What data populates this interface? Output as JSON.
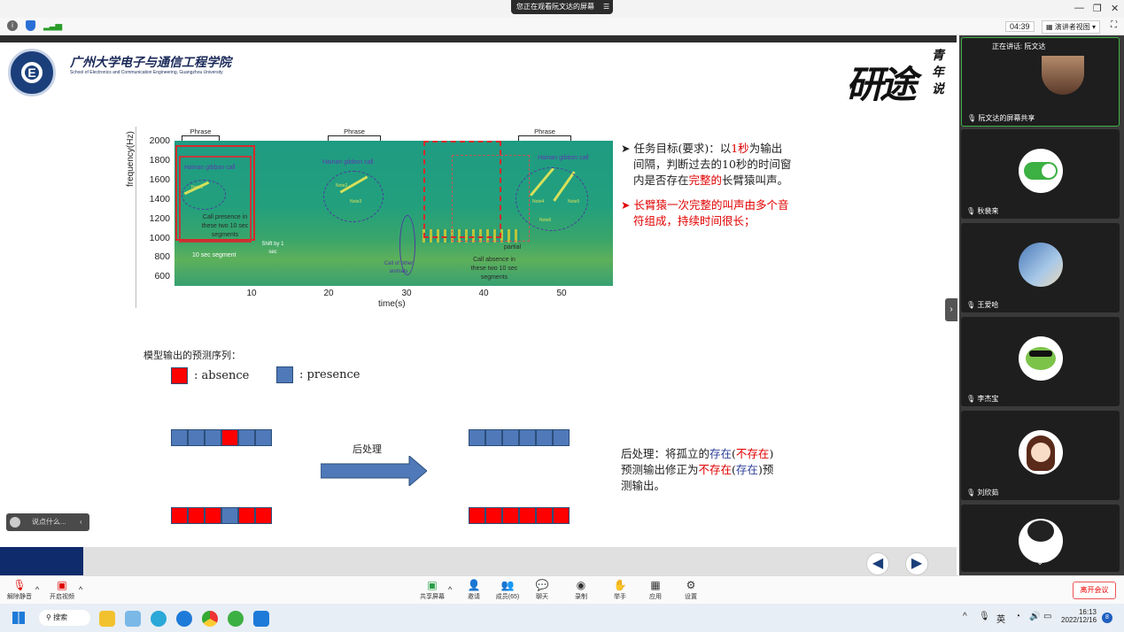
{
  "window": {
    "banner": "您正在观看阮文达的屏幕",
    "timer": "04:39",
    "view_mode": "演讲者视图"
  },
  "slide": {
    "school_cn": "广州大学电子与通信工程学院",
    "school_en": "School of Electronics and Communication Engineering, Guangzhou University",
    "brand": "研途",
    "brand_sub": "青年说",
    "spectrogram": {
      "ylabel": "frequency(Hz)",
      "xlabel": "time(s)",
      "yticks": [
        "2000",
        "1800",
        "1600",
        "1400",
        "1200",
        "1000",
        "800",
        "600"
      ],
      "xticks": [
        "10",
        "20",
        "30",
        "40",
        "50"
      ],
      "phrase_labels": [
        "Phrase",
        "Phrase",
        "Phrase"
      ],
      "annotations": {
        "gibbon1": "Hainan gibbon call",
        "gibbon2": "Hainan gibbon call",
        "gibbon3": "Hainan gibbon call",
        "note1": "Note1",
        "note2": "Note2",
        "note3": "Note3",
        "note4": "Note4",
        "note5": "Note5",
        "note6": "Note6",
        "presence": "Call presence in these two 10 sec segments",
        "shift": "Shift by 1 sec",
        "segment": "10 sec segment",
        "other": "Call of other animals",
        "absence": "Call absence in these two 10 sec segments",
        "partial": "partial"
      }
    },
    "task": {
      "line1_pre": "任务目标(要求)：以",
      "line1_red": "1秒",
      "line1_post": "为输出",
      "line2": "间隔，判断过去的10秒的时间窗",
      "line3_pre": "内是否存在",
      "line3_red": "完整的",
      "line3_post": "长臂猿叫声。",
      "line4": "长臂猿一次完整的叫声由多个音",
      "line5": "符组成，持续时间很长；"
    },
    "legend": {
      "title": "模型输出的预测序列：",
      "absence": ": absence",
      "presence": ": presence"
    },
    "post": {
      "arrow_label": "后处理",
      "t1": "后处理：将孤立的",
      "t2": "存在",
      "t3": "(",
      "t4": "不存在",
      "t5": ")",
      "t6": "预测输出修正为",
      "t7": "不存在",
      "t8": "(",
      "t9": "存在",
      "t10": ")",
      "t11": "预",
      "t12": "测输出。"
    },
    "sequences": {
      "row1_in": [
        "p",
        "p",
        "p",
        "a",
        "p",
        "p"
      ],
      "row1_out": [
        "p",
        "p",
        "p",
        "p",
        "p",
        "p"
      ],
      "row2_in": [
        "a",
        "a",
        "a",
        "p",
        "a",
        "a"
      ],
      "row2_out": [
        "a",
        "a",
        "a",
        "a",
        "a",
        "a"
      ]
    },
    "colors": {
      "absence": "#ff0000",
      "presence": "#4f79b8"
    }
  },
  "chat": {
    "placeholder": "说点什么..."
  },
  "panel": {
    "speaking": "正在讲话: 阮文达",
    "tiles": [
      {
        "name": "阮文达的屏幕共享"
      },
      {
        "name": "秋裴来"
      },
      {
        "name": "王爱哈"
      },
      {
        "name": "李杰宝"
      },
      {
        "name": "刘欣茹"
      }
    ]
  },
  "toolbar": {
    "mute": "解除静音",
    "video": "开启视频",
    "share": "共享屏幕",
    "invite": "邀请",
    "members": "成员(65)",
    "chat": "聊天",
    "record": "录制",
    "hand": "举手",
    "apps": "应用",
    "settings": "设置",
    "leave": "离开会议"
  },
  "taskbar": {
    "search": "搜索",
    "lang": "英",
    "time": "16:13",
    "date": "2022/12/16",
    "badge": "8"
  }
}
